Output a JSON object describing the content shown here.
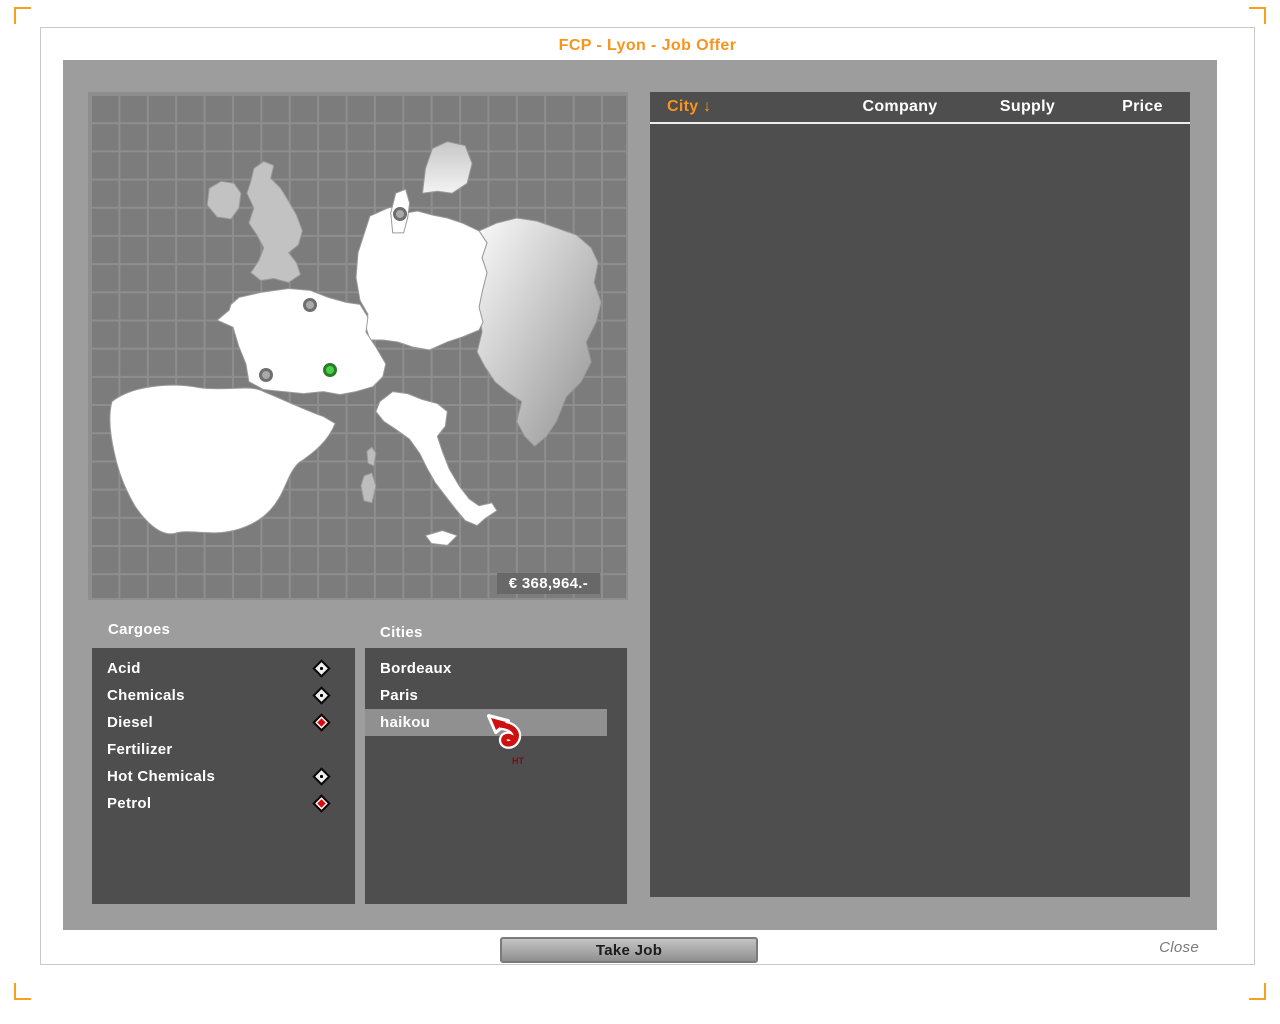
{
  "window": {
    "title": "FCP - Lyon - Job Offer"
  },
  "map": {
    "money": "€ 368,964.-",
    "markers": [
      {
        "type": "gray",
        "x": 57.8,
        "y": 23.8
      },
      {
        "type": "gray",
        "x": 41.1,
        "y": 41.9
      },
      {
        "type": "gray",
        "x": 32.8,
        "y": 55.7
      },
      {
        "type": "green",
        "x": 44.8,
        "y": 54.7
      }
    ]
  },
  "cargoes": {
    "label": "Cargoes",
    "items": [
      {
        "name": "Acid",
        "icon": "hazard-diamond-light"
      },
      {
        "name": "Chemicals",
        "icon": "hazard-diamond-light"
      },
      {
        "name": "Diesel",
        "icon": "hazard-diamond-red"
      },
      {
        "name": "Fertilizer",
        "icon": ""
      },
      {
        "name": "Hot Chemicals",
        "icon": "hazard-diamond-light"
      },
      {
        "name": "Petrol",
        "icon": "hazard-diamond-red"
      }
    ]
  },
  "cities": {
    "label": "Cities",
    "items": [
      {
        "name": "Bordeaux",
        "selected": false
      },
      {
        "name": "Paris",
        "selected": false
      },
      {
        "name": "haikou",
        "selected": true
      }
    ]
  },
  "job_table": {
    "columns": [
      "City ↓",
      "Company",
      "Supply",
      "Price"
    ],
    "rows": []
  },
  "footer": {
    "take_job": "Take Job",
    "close": "Close"
  },
  "cursor": {
    "label": "HT"
  },
  "colors": {
    "accent_orange": "#f7941d",
    "dialog_gray": "#9d9d9d",
    "panel_dark": "#4e4e4e",
    "hazard_red": "#dd0808",
    "marker_green": "#45d245"
  }
}
